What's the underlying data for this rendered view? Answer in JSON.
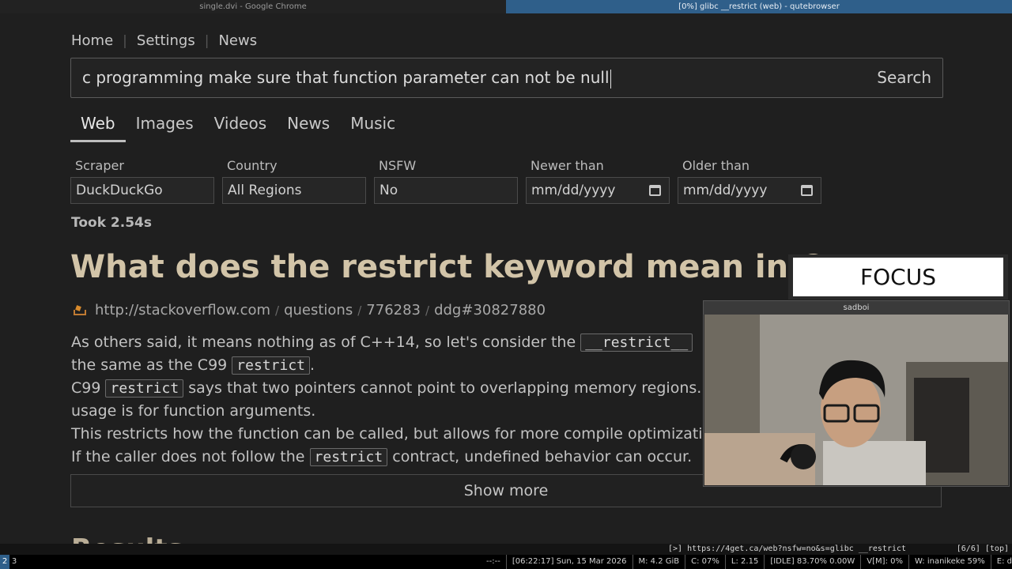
{
  "window_titles": {
    "left": "single.dvi - Google Chrome",
    "right": "[0%] glibc __restrict (web) - qutebrowser"
  },
  "nav": {
    "items": [
      "Home",
      "Settings",
      "News"
    ]
  },
  "search": {
    "query": "c programming make sure that function parameter can not be null",
    "button_label": "Search"
  },
  "tabs": [
    "Web",
    "Images",
    "Videos",
    "News",
    "Music"
  ],
  "filters": [
    {
      "label": "Scraper",
      "value": "DuckDuckGo"
    },
    {
      "label": "Country",
      "value": "All Regions"
    },
    {
      "label": "NSFW",
      "value": "No"
    },
    {
      "label": "Newer than",
      "value": "mm/dd/yyyy"
    },
    {
      "label": "Older than",
      "value": "mm/dd/yyyy"
    }
  ],
  "took": "Took 2.54s",
  "result": {
    "title": "What does the restrict keyword mean in C++",
    "url_parts": [
      "http://stackoverflow.com",
      "questions",
      "776283",
      "ddg#30827880"
    ],
    "snippet": {
      "l1a": "As others said, it means nothing as of C++14, so let's consider the ",
      "l1code": "__restrict__",
      "l2a": "the same as the C99 ",
      "l2code": "restrict",
      "l2b": ".",
      "l3a": "C99 ",
      "l3code": "restrict",
      "l3b": " says that two pointers cannot point to overlapping memory regions.",
      "l4": "usage is for function arguments.",
      "l5": "This restricts how the function can be called, but allows for more compile optimizations.",
      "l6a": "If the caller does not follow the ",
      "l6code": "restrict",
      "l6b": " contract, undefined behavior can occur."
    },
    "show_more": "Show more"
  },
  "next_heading": "Results",
  "overlay": {
    "focus_text": "FOCUS",
    "cam_title": "sadboi"
  },
  "qute_status": {
    "url": "[>] https://4get.ca/web?nsfw=no&s=glibc __restrict",
    "pos": "[6/6] [top]"
  },
  "i3bar": {
    "workspaces": [
      "2",
      "3"
    ],
    "items": [
      "--:--",
      "[06:22:17] Sun, 15 Mar 2026",
      "M: 4.2 GiB",
      "C: 07%",
      "L: 2.15",
      "[IDLE] 83.70% 0.00W",
      "V[M]: 0%",
      "W: inanikeke 59%",
      "E: down"
    ]
  },
  "colors": {
    "accent_blue": "#2f5f8a",
    "title_tan": "#d2c4a8",
    "background": "#1f1f1f"
  }
}
